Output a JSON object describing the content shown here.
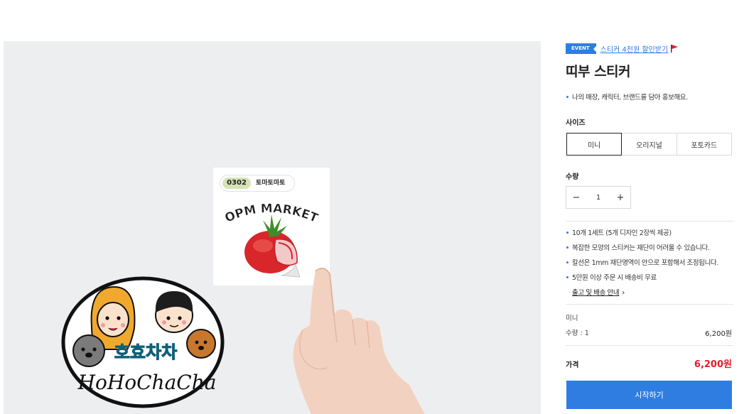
{
  "gallery": {
    "card": {
      "code": "0302",
      "name": "토마토마토"
    },
    "artwork": {
      "card_brand": "OPM MARKET",
      "oval_korean": "호효차차",
      "oval_english": "HoHoChaCha"
    }
  },
  "panel": {
    "event": {
      "badge": "EVENT",
      "link": "스티커 4천원 할인받기"
    },
    "title": "띠부 스티커",
    "description": "나의 매장, 캐릭터, 브랜드를 담아 홍보해요.",
    "size": {
      "label": "사이즈",
      "options": [
        "미니",
        "오리지널",
        "포토카드"
      ],
      "selected": "미니"
    },
    "quantity": {
      "label": "수량",
      "minus": "−",
      "value": "1",
      "plus": "+"
    },
    "notes": [
      "10개 1세트 (5개 디자인 2장씩 제공)",
      "복잡한 모양의 스티커는 재단이 어려울 수 있습니다.",
      "칼선은 1mm 재단영역이 안으로 포함해서 조정됩니다.",
      "5만원 이상 주문 시 배송비 무료"
    ],
    "shipping_link": "출고 및 배송 안내",
    "summary": {
      "option": "미니",
      "quantity": "수량 : 1",
      "price": "6,200원"
    },
    "total": {
      "label": "가격",
      "price": "6,200원"
    },
    "start_button": "시작하기",
    "colors": {
      "accent": "#2f7de1",
      "price_red": "#e0202e",
      "gallery_bg": "#edeef0",
      "tag_green": "#d5e3b6"
    }
  }
}
